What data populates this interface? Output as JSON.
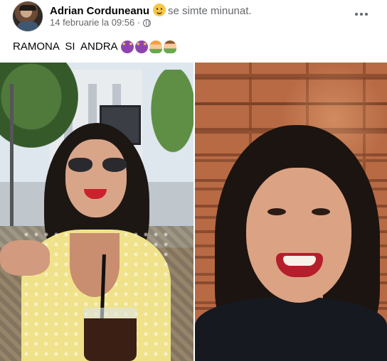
{
  "post": {
    "author": "Adrian Corduneanu",
    "feeling_emoji": "slightly-smiling-face-emoji",
    "feeling_text": "se simte minunat.",
    "timestamp": "14 februarie la 09:56",
    "separator": "·",
    "privacy_icon": "globe-icon",
    "more_icon": "more-options-icon",
    "text": "RAMONA  SI  ANDRA",
    "text_emojis": [
      "star-struck-emoji",
      "star-struck-emoji",
      "woman-raising-hand-emoji",
      "man-raising-hand-emoji"
    ]
  },
  "photos": [
    {
      "name": "photo-left"
    },
    {
      "name": "photo-right"
    }
  ]
}
